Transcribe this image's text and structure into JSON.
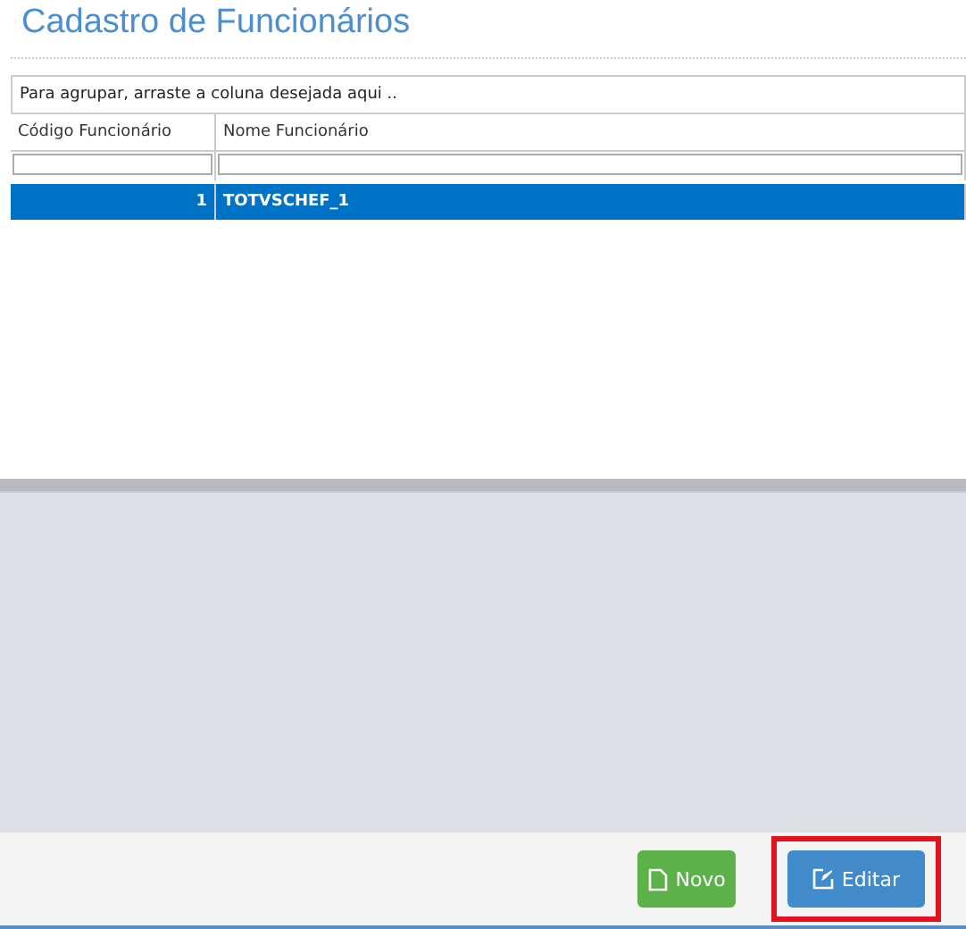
{
  "title": "Cadastro de Funcionários",
  "group_panel": {
    "text": "Para agrupar, arraste a coluna desejada aqui .."
  },
  "table": {
    "columns": [
      "Código Funcionário",
      "Nome Funcionário"
    ],
    "rows": [
      {
        "cells": [
          "1",
          "TOTVSCHEF_1"
        ],
        "selected": true
      }
    ]
  },
  "buttons": [
    {
      "kind": "new",
      "label": "Novo",
      "highlighted": false
    },
    {
      "kind": "edit",
      "label": "Editar",
      "highlighted": true
    }
  ]
}
